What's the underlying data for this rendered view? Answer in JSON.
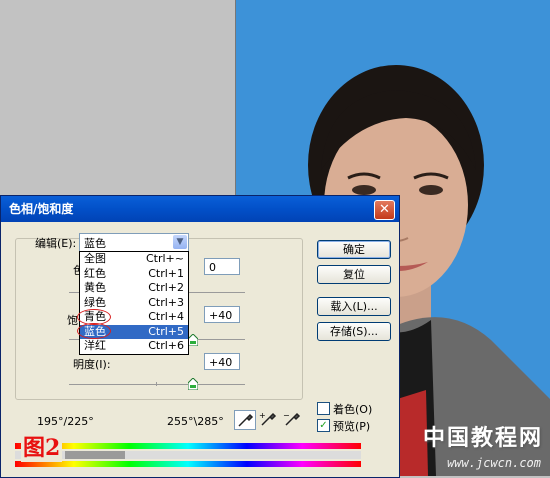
{
  "watermark": {
    "text": "中国教程网",
    "url": "www.jcwcn.com"
  },
  "dialog": {
    "title": "色相/饱和度",
    "edit": {
      "label": "编辑(E):",
      "value": "蓝色"
    },
    "dropdown_options": [
      {
        "label": "全图",
        "shortcut": "Ctrl+~"
      },
      {
        "label": "红色",
        "shortcut": "Ctrl+1"
      },
      {
        "label": "黄色",
        "shortcut": "Ctrl+2"
      },
      {
        "label": "绿色",
        "shortcut": "Ctrl+3"
      },
      {
        "label": "青色",
        "shortcut": "Ctrl+4"
      },
      {
        "label": "蓝色",
        "shortcut": "Ctrl+5"
      },
      {
        "label": "洋红",
        "shortcut": "Ctrl+6"
      }
    ],
    "selected_option": "蓝色",
    "hue": {
      "label": "色",
      "value": "0"
    },
    "saturation": {
      "label": "饱",
      "value": "+40"
    },
    "lightness": {
      "label": "明度(I):",
      "value": "+40"
    },
    "range_left": "195°/225°",
    "range_right": "255°\\285°",
    "buttons": {
      "ok": "确定",
      "reset": "复位",
      "load": "载入(L)...",
      "save": "存储(S)..."
    },
    "colorize": {
      "label": "着色(O)",
      "checked": false
    },
    "preview": {
      "label": "预览(P)",
      "checked": true
    },
    "figure_label": "图2"
  },
  "colors": {
    "titlebar": "#0250c8",
    "photo_bg": "#3d92d8",
    "selection": "#316ac5",
    "annotation_red": "#e81010"
  }
}
